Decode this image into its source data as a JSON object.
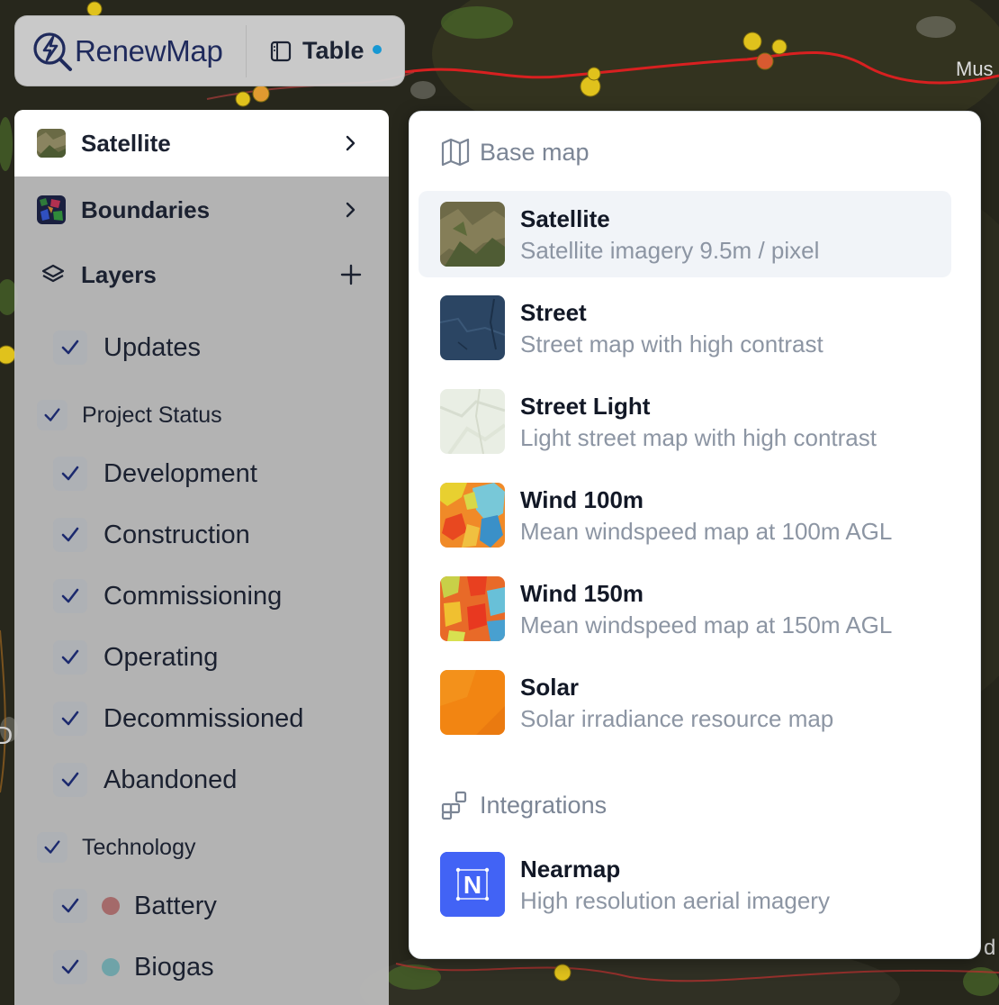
{
  "app": {
    "name": "RenewMap",
    "table_label": "Table"
  },
  "map": {
    "edge_labels": [
      "Mus",
      "D",
      "d"
    ]
  },
  "left_panel": {
    "basemap_label": "Satellite",
    "boundaries_label": "Boundaries",
    "layers_label": "Layers",
    "updates_label": "Updates",
    "project_status": {
      "label": "Project Status",
      "items": [
        "Development",
        "Construction",
        "Commissioning",
        "Operating",
        "Decommissioned",
        "Abandoned"
      ]
    },
    "technology": {
      "label": "Technology",
      "items": [
        {
          "label": "Battery",
          "color": "#a46a6a"
        },
        {
          "label": "Biogas",
          "color": "#6fa3a8"
        }
      ]
    }
  },
  "dropdown": {
    "base_map_header": "Base map",
    "options": [
      {
        "title": "Satellite",
        "desc": "Satellite imagery 9.5m / pixel",
        "selected": true
      },
      {
        "title": "Street",
        "desc": "Street map with high contrast"
      },
      {
        "title": "Street Light",
        "desc": "Light street map with high contrast"
      },
      {
        "title": "Wind 100m",
        "desc": "Mean windspeed map at 100m AGL"
      },
      {
        "title": "Wind 150m",
        "desc": "Mean windspeed map at 150m AGL"
      },
      {
        "title": "Solar",
        "desc": "Solar irradiance resource map"
      }
    ],
    "integrations_header": "Integrations",
    "integrations": [
      {
        "title": "Nearmap",
        "desc": "High resolution aerial imagery",
        "color": "#4263f5"
      }
    ]
  }
}
